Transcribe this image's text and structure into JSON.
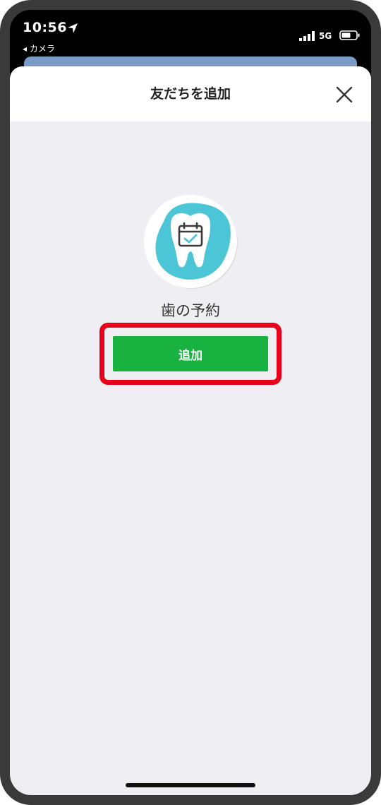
{
  "status_bar": {
    "time": "10:56",
    "back_app": "◂ カメラ",
    "network": "5G",
    "location_icon": "location-arrow-icon",
    "signal_icon": "signal-bars-icon",
    "battery_icon": "battery-icon"
  },
  "sheet": {
    "title": "友だちを追加",
    "close_icon": "close-icon"
  },
  "account": {
    "name": "歯の予約",
    "avatar_icon": "tooth-calendar-icon"
  },
  "actions": {
    "add_label": "追加"
  },
  "colors": {
    "accent_green": "#17b23f",
    "highlight_red": "#e8001a",
    "avatar_teal": "#4cc6d6",
    "sheet_background": "#efeef3"
  }
}
